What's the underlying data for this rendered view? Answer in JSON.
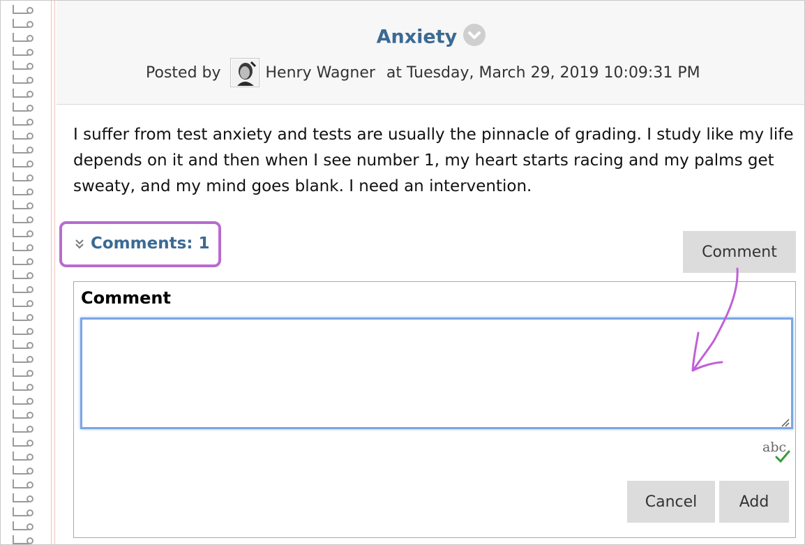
{
  "post": {
    "title": "Anxiety",
    "posted_by_label": "Posted by",
    "author": "Henry Wagner",
    "timestamp": "at Tuesday, March 29, 2019 10:09:31 PM",
    "body": "I suffer from test anxiety and tests are usually the pinnacle of grading. I study like my life depends on it and then when I see number 1, my heart starts racing and my palms get sweaty, and my mind goes blank. I need an intervention."
  },
  "comments": {
    "toggle_label": "Comments: 1",
    "comment_button": "Comment",
    "form_label": "Comment",
    "textarea_value": "",
    "cancel_button": "Cancel",
    "add_button": "Add"
  },
  "colors": {
    "title": "#3b6a93",
    "highlight": "#b86bd0",
    "button_bg": "#dcdcdc",
    "focus_border": "#7aa6e4"
  },
  "icons": [
    "title-options-icon",
    "author-avatar",
    "expand-chevrons-icon",
    "resize-grip-icon",
    "spellcheck-icon"
  ]
}
